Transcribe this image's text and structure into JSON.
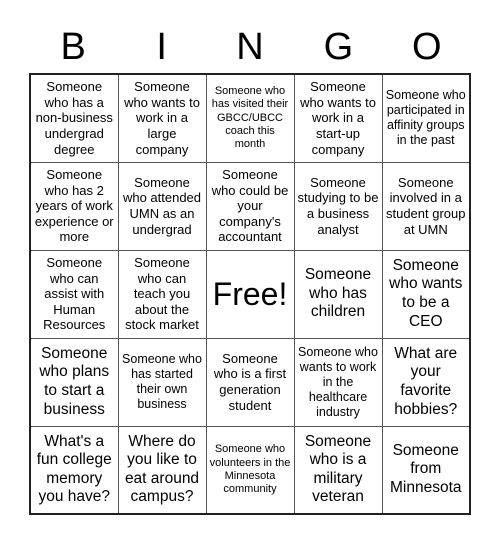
{
  "header": {
    "letters": [
      "B",
      "I",
      "N",
      "G",
      "O"
    ]
  },
  "rows": [
    [
      "Someone who has a non-business undergrad degree",
      "Someone who wants to work in a large company",
      "Someone who has visited their GBCC/UBCC coach this month",
      "Someone who wants to work in a start-up company",
      "Someone who participated in affinity groups in the past"
    ],
    [
      "Someone who has 2 years of work experience or more",
      "Someone who attended UMN as an undergrad",
      "Someone who could be your company's accountant",
      "Someone studying to be a business analyst",
      "Someone involved in a student group at UMN"
    ],
    [
      "Someone who can assist with Human Resources",
      "Someone who can teach you about the stock market",
      "Free!",
      "Someone who has children",
      "Someone who wants to be a CEO"
    ],
    [
      "Someone who plans to start a business",
      "Someone who has started their own business",
      "Someone who is a first generation student",
      "Someone who wants to work in the healthcare industry",
      "What are your favorite hobbies?"
    ],
    [
      "What's a fun college memory you have?",
      "Where do you like to eat around campus?",
      "Someone who volunteers in the Minnesota community",
      "Someone who is a military veteran",
      "Someone from Minnesota"
    ]
  ]
}
